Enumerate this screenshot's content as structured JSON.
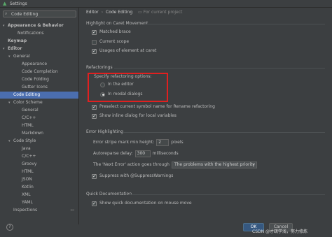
{
  "window": {
    "title": "Settings"
  },
  "search": {
    "value": "Code Editing"
  },
  "sidebar": {
    "items": [
      {
        "label": "Appearance & Behavior",
        "arrow": "▾",
        "bold": true
      },
      {
        "label": "Notifications",
        "arrow": "",
        "bold": false
      },
      {
        "label": "Keymap",
        "arrow": "",
        "bold": true
      },
      {
        "label": "Editor",
        "arrow": "▾",
        "bold": true
      },
      {
        "label": "General",
        "arrow": "▾",
        "bold": false
      },
      {
        "label": "Appearance",
        "arrow": "",
        "bold": false
      },
      {
        "label": "Code Completion",
        "arrow": "",
        "bold": false
      },
      {
        "label": "Code Folding",
        "arrow": "",
        "bold": false
      },
      {
        "label": "Gutter Icons",
        "arrow": "",
        "bold": false
      },
      {
        "label": "Code Editing",
        "arrow": "",
        "bold": false
      },
      {
        "label": "Color Scheme",
        "arrow": "▾",
        "bold": false
      },
      {
        "label": "General",
        "arrow": "",
        "bold": false
      },
      {
        "label": "C/C++",
        "arrow": "",
        "bold": false
      },
      {
        "label": "HTML",
        "arrow": "",
        "bold": false
      },
      {
        "label": "Markdown",
        "arrow": "",
        "bold": false
      },
      {
        "label": "Code Style",
        "arrow": "▾",
        "bold": false
      },
      {
        "label": "Java",
        "arrow": "",
        "bold": false
      },
      {
        "label": "C/C++",
        "arrow": "",
        "bold": false
      },
      {
        "label": "Groovy",
        "arrow": "",
        "bold": false
      },
      {
        "label": "HTML",
        "arrow": "",
        "bold": false
      },
      {
        "label": "JSON",
        "arrow": "",
        "bold": false
      },
      {
        "label": "Kotlin",
        "arrow": "",
        "bold": false
      },
      {
        "label": "XML",
        "arrow": "",
        "bold": false
      },
      {
        "label": "YAML",
        "arrow": "",
        "bold": false
      },
      {
        "label": "Inspections",
        "arrow": "",
        "bold": false
      }
    ],
    "selected_index": 9
  },
  "breadcrumb": {
    "root": "Editor",
    "sep": "›",
    "current": "Code Editing",
    "project_note": "For current project"
  },
  "caret": {
    "title": "Highlight on Caret Movement",
    "matched_brace": "Matched brace",
    "current_scope": "Current scope",
    "usages": "Usages of element at caret"
  },
  "refactorings": {
    "title": "Refactorings",
    "options_label": "Specify refactoring options:",
    "in_editor": "In the editor",
    "in_modal": "In modal dialogs",
    "preselect": "Preselect current symbol name for Rename refactoring",
    "inline_dialog": "Show inline dialog for local variables"
  },
  "errors": {
    "title": "Error Highlighting",
    "stripe_label": "Error stripe mark min height:",
    "stripe_value": "2",
    "stripe_unit": "pixels",
    "autoreparse_label": "Autoreparse delay:",
    "autoreparse_value": "300",
    "autoreparse_unit": "milliseconds",
    "next_error_label": "The 'Next Error' action goes through",
    "next_error_value": "The problems with the highest priority",
    "suppress": "Suppress with @SuppressWarnings"
  },
  "quickdoc": {
    "title": "Quick Documentation",
    "show_on_hover": "Show quick documentation on mouse move"
  },
  "footer": {
    "ok": "OK",
    "cancel": "Cancel"
  },
  "watermark": "CSDN @才疏学浅，努力修炼",
  "help": "?"
}
